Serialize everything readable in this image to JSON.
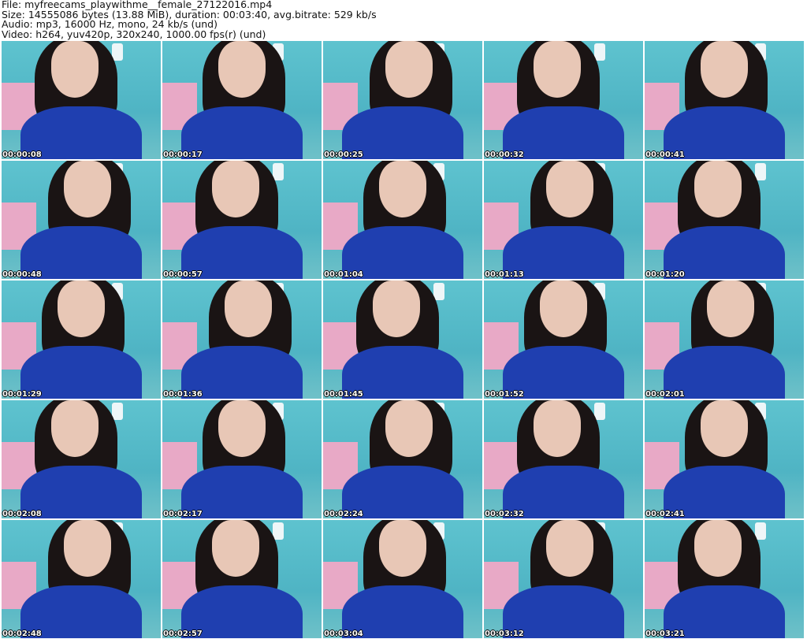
{
  "info": {
    "file": "File: myfreecams_playwithme__female_27122016.mp4",
    "size": "Size: 14555086 bytes (13.88 MiB), duration: 00:03:40, avg.bitrate: 529 kb/s",
    "audio": "Audio: mp3, 16000 Hz, mono, 24 kb/s (und)",
    "video": "Video: h264, yuv420p, 320x240, 1000.00 fps(r) (und)"
  },
  "timestamps": [
    "00:00:08",
    "00:00:17",
    "00:00:25",
    "00:00:32",
    "00:00:41",
    "00:00:48",
    "00:00:57",
    "00:01:04",
    "00:01:13",
    "00:01:20",
    "00:01:29",
    "00:01:36",
    "00:01:45",
    "00:01:52",
    "00:02:01",
    "00:02:08",
    "00:02:17",
    "00:02:24",
    "00:02:32",
    "00:02:41",
    "00:02:48",
    "00:02:57",
    "00:03:04",
    "00:03:12",
    "00:03:21"
  ]
}
